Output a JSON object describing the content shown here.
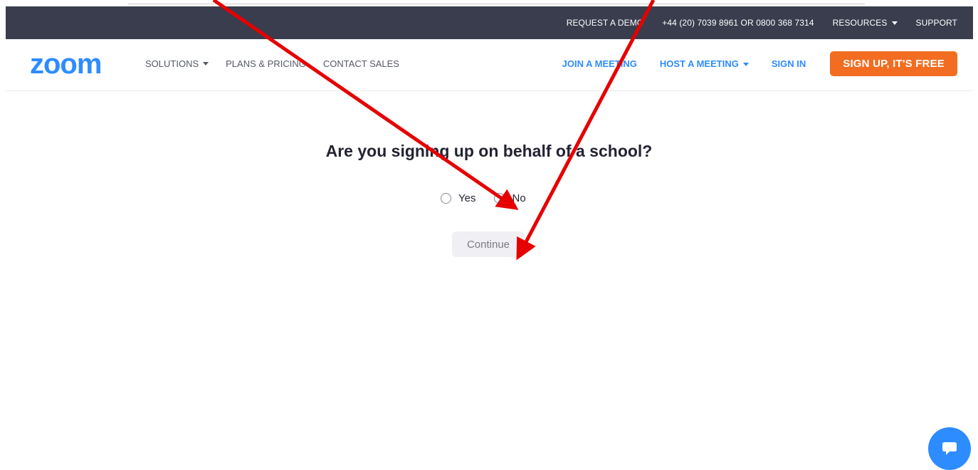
{
  "utility_bar": {
    "request_demo": "REQUEST A DEMO",
    "phone": "+44 (20) 7039 8961 OR 0800 368 7314",
    "resources": "RESOURCES",
    "support": "SUPPORT"
  },
  "navbar": {
    "logo_text": "zoom",
    "solutions": "SOLUTIONS",
    "plans_pricing": "PLANS & PRICING",
    "contact_sales": "CONTACT SALES",
    "join_meeting": "JOIN A MEETING",
    "host_meeting": "HOST A MEETING",
    "sign_in": "SIGN IN",
    "sign_up": "SIGN UP, IT'S FREE"
  },
  "main": {
    "question": "Are you signing up on behalf of a school?",
    "options": [
      {
        "label": "Yes",
        "selected": false
      },
      {
        "label": "No",
        "selected": false
      }
    ],
    "continue_label": "Continue"
  },
  "icons": {
    "chat": "chat-bubble-icon",
    "caret": "caret-down-icon"
  },
  "colors": {
    "brand_blue": "#2d8cff",
    "utility_bar_bg": "#393d4d",
    "signup_orange": "#f26d21",
    "annotation_red": "#e60000"
  }
}
